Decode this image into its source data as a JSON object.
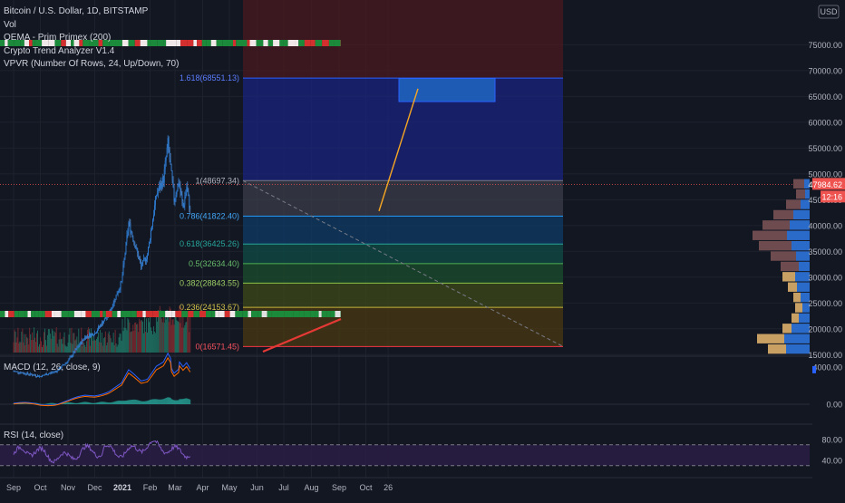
{
  "legend": {
    "symbol": "Bitcoin / U.S. Dollar, 1D, BITSTAMP",
    "vol": "Vol",
    "ema": "OEMA - Prim Primex (200)",
    "trend": "Crypto Trend Analyzer V1.4",
    "vpvr": "VPVR (Number Of Rows, 24, Up/Down, 70)"
  },
  "macd": {
    "label": "MACD (12, 26, close, 9)",
    "ticks": [
      "4000.00",
      "0.00"
    ]
  },
  "rsi": {
    "label": "RSI (14, close)",
    "ticks": [
      "80.00",
      "40.00"
    ]
  },
  "currency": "USD",
  "colors": {
    "background": "#131722",
    "up": "#26a69a",
    "down": "#ef5350",
    "candle": "#2f7fd8",
    "fib_line": "#2196f3"
  },
  "chart_data": {
    "type": "candlestick",
    "title": "Bitcoin / U.S. Dollar, 1D, BITSTAMP",
    "ylim": [
      14000,
      75000
    ],
    "y_ticks": [
      75000,
      70000,
      65000,
      60000,
      55000,
      50000,
      45000,
      40000,
      35000,
      30000,
      25000,
      20000,
      15000
    ],
    "x_ticks": [
      "Sep",
      "Oct",
      "Nov",
      "Dec",
      "2021",
      "Feb",
      "Mar",
      "Apr",
      "May",
      "Jun",
      "Jul",
      "Aug",
      "Sep",
      "Oct",
      "26"
    ],
    "last_price": "47984.62",
    "countdown": "12:16",
    "price_series": [
      [
        "2020-09-01",
        11800
      ],
      [
        "2020-10-01",
        10800
      ],
      [
        "2020-10-20",
        11900
      ],
      [
        "2020-11-01",
        13800
      ],
      [
        "2020-11-20",
        18400
      ],
      [
        "2020-12-01",
        19200
      ],
      [
        "2020-12-17",
        23000
      ],
      [
        "2020-12-31",
        29000
      ],
      [
        "2021-01-08",
        40500
      ],
      [
        "2021-01-14",
        37000
      ],
      [
        "2021-01-22",
        32000
      ],
      [
        "2021-01-29",
        34300
      ],
      [
        "2021-02-08",
        46000
      ],
      [
        "2021-02-16",
        49000
      ],
      [
        "2021-02-21",
        56000
      ],
      [
        "2021-02-28",
        45000
      ],
      [
        "2021-03-05",
        48500
      ],
      [
        "2021-03-10",
        43500
      ],
      [
        "2021-03-14",
        47500
      ],
      [
        "2021-03-18",
        42800
      ]
    ],
    "fibonacci": [
      {
        "label": "1.618(68551.13)",
        "price": 68551.13
      },
      {
        "label": "1(48697.34)",
        "price": 48697.34
      },
      {
        "label": "0.786(41822.40)",
        "price": 41822.4
      },
      {
        "label": "0.618(36425.26)",
        "price": 36425.26
      },
      {
        "label": "0.5(32634.40)",
        "price": 32634.4
      },
      {
        "label": "0.382(28843.55)",
        "price": 28843.55
      },
      {
        "label": "0.236(24153.67)",
        "price": 24153.67
      },
      {
        "label": "0(16571.45)",
        "price": 16571.45
      }
    ],
    "projection": {
      "from": [
        "2021-03-18",
        42800
      ],
      "to": [
        "2021-04-04",
        66500
      ],
      "target_zone": [
        64000,
        68500
      ]
    },
    "volume_profile": {
      "bins": [
        [
          48000,
          6,
          12
        ],
        [
          46000,
          5,
          10
        ],
        [
          44000,
          10,
          16
        ],
        [
          42000,
          18,
          22
        ],
        [
          40000,
          22,
          30
        ],
        [
          38000,
          25,
          38
        ],
        [
          36000,
          20,
          36
        ],
        [
          34000,
          15,
          28
        ],
        [
          32000,
          12,
          20
        ],
        [
          30000,
          16,
          14
        ],
        [
          28000,
          14,
          10
        ],
        [
          26000,
          10,
          8
        ],
        [
          24000,
          8,
          8
        ],
        [
          22000,
          12,
          8
        ],
        [
          20000,
          20,
          10
        ],
        [
          18000,
          28,
          30
        ],
        [
          16000,
          26,
          20
        ]
      ]
    },
    "macd_range": [
      -1500,
      5000
    ],
    "rsi_levels": [
      70,
      30
    ]
  }
}
